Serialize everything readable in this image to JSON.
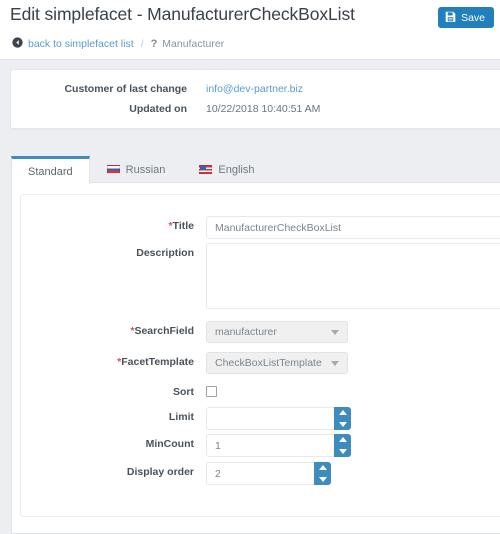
{
  "header": {
    "title": "Edit simplefacet - ManufacturerCheckBoxList",
    "save_label": "Save",
    "save_icon": "save-floppy-icon"
  },
  "breadcrumb": {
    "back_icon": "back-arrow-circle-icon",
    "back_label": "back to simplefacet list",
    "separator": "/",
    "help_icon": "?",
    "current": "Manufacturer"
  },
  "info": {
    "rows": [
      {
        "label": "Customer of last change",
        "value": "info@dev-partner.biz",
        "is_link": true
      },
      {
        "label": "Updated on",
        "value": "10/22/2018 10:40:51 AM",
        "is_link": false
      }
    ]
  },
  "tabs": [
    {
      "label": "Standard",
      "flag": "",
      "active": true
    },
    {
      "label": "Russian",
      "flag": "flag-russia-icon",
      "active": false
    },
    {
      "label": "English",
      "flag": "flag-usa-icon",
      "active": false
    }
  ],
  "form": {
    "title": {
      "label": "Title",
      "required": true,
      "value": "ManufacturerCheckBoxList"
    },
    "description": {
      "label": "Description",
      "required": false,
      "value": ""
    },
    "search_field": {
      "label": "SearchField",
      "required": true,
      "value": "manufacturer"
    },
    "facet_template": {
      "label": "FacetTemplate",
      "required": true,
      "value": "CheckBoxListTemplate"
    },
    "sort": {
      "label": "Sort",
      "required": false,
      "checked": false
    },
    "limit": {
      "label": "Limit",
      "required": false,
      "value": ""
    },
    "min_count": {
      "label": "MinCount",
      "required": false,
      "value": "1"
    },
    "display_order": {
      "label": "Display order",
      "required": false,
      "value": "2"
    }
  },
  "colors": {
    "accent_blue": "#2180bb",
    "tab_active_blue": "#3c8dbc",
    "spinner_blue": "#3d8cbb",
    "link_blue": "#5b9bd1",
    "required_red": "#d9534f",
    "page_background": "#eceef2"
  }
}
